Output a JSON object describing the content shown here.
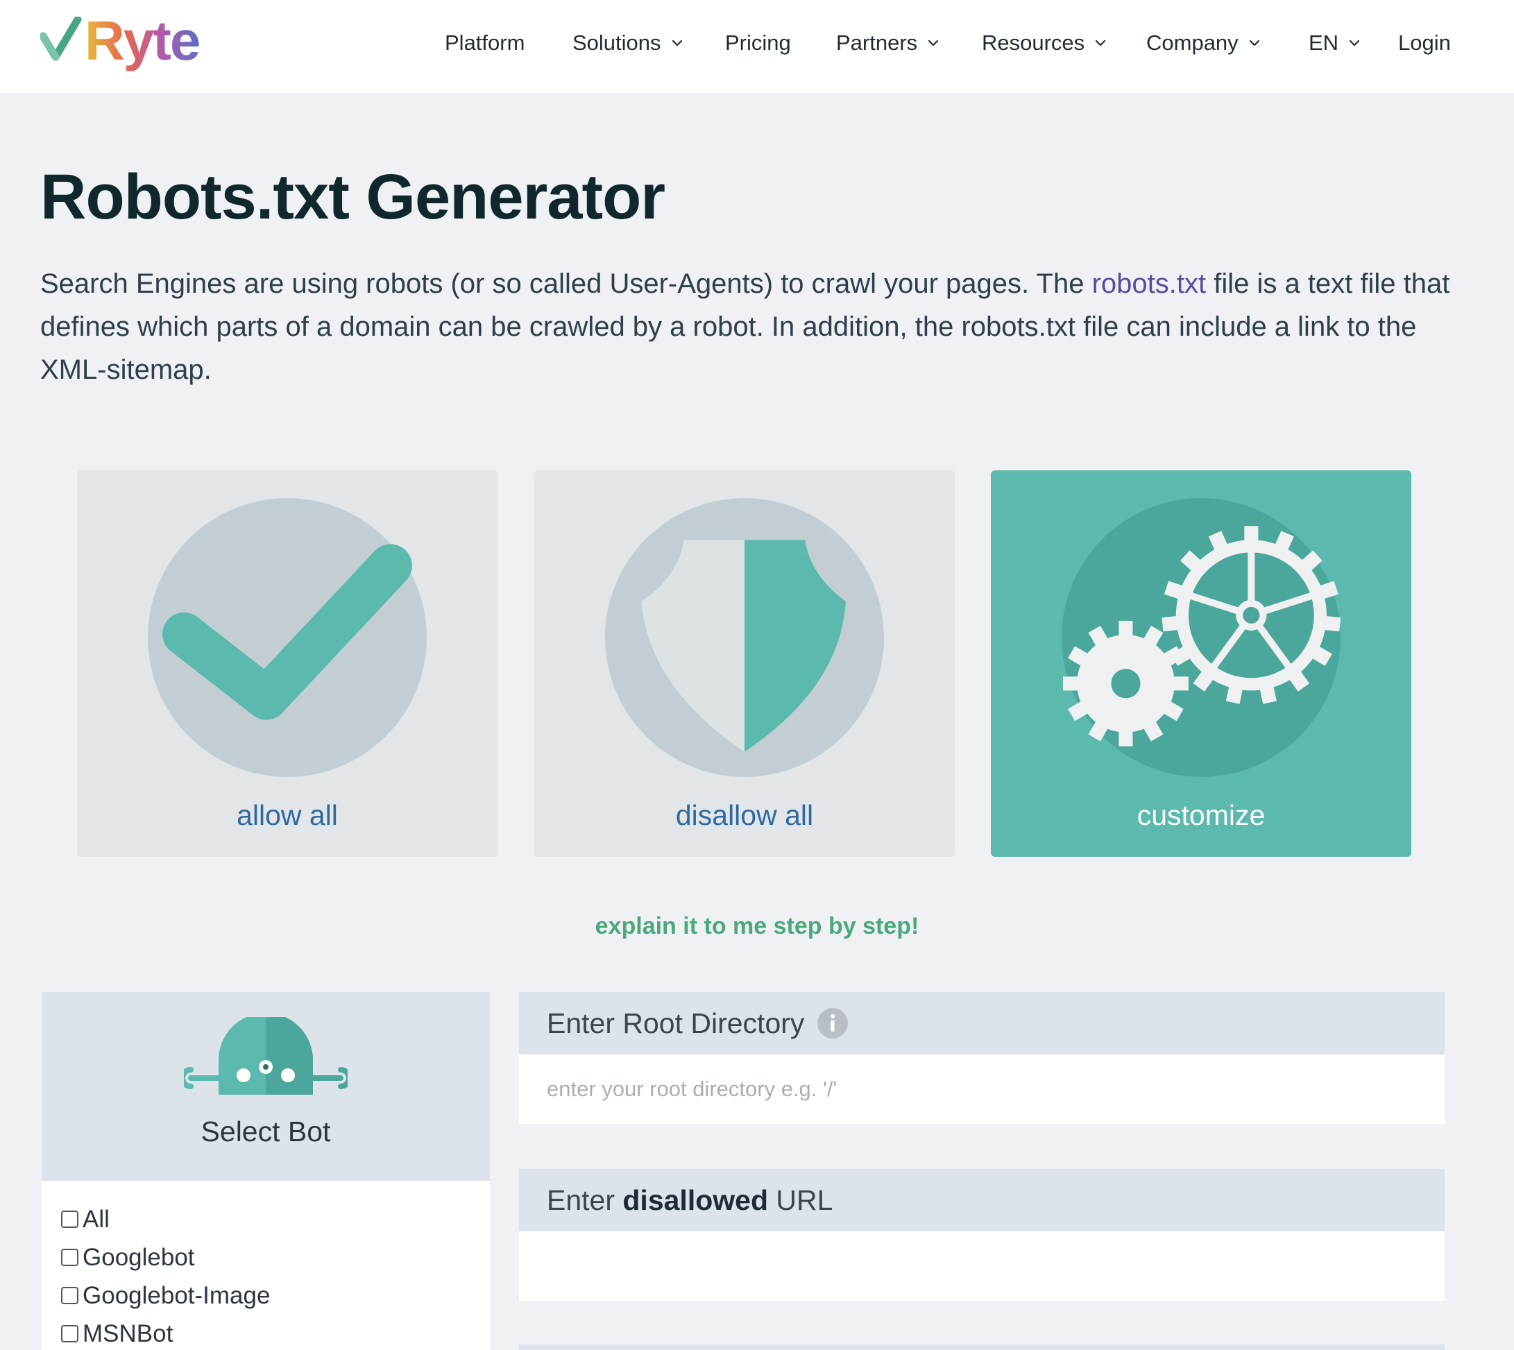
{
  "header": {
    "logo_text": "Ryte",
    "nav": [
      {
        "label": "Platform",
        "dropdown": false
      },
      {
        "label": "Solutions",
        "dropdown": true
      },
      {
        "label": "Pricing",
        "dropdown": false
      },
      {
        "label": "Partners",
        "dropdown": true
      },
      {
        "label": "Resources",
        "dropdown": true
      },
      {
        "label": "Company",
        "dropdown": true
      },
      {
        "label": "EN",
        "dropdown": true
      },
      {
        "label": "Login",
        "dropdown": false
      }
    ]
  },
  "main": {
    "title": "Robots.txt Generator",
    "intro_part1": "Search Engines are using robots (or so called User-Agents) to crawl your pages. The ",
    "intro_link": "robots.txt",
    "intro_part2": " file is a text file that defines which parts of a domain can be crawled by a robot. In addition, the robots.txt file can include a link to the XML-sitemap."
  },
  "options": {
    "allow_label": "allow all",
    "disallow_label": "disallow all",
    "customize_label": "customize",
    "selected": "customize"
  },
  "explain_link": "explain it to me step by step!",
  "bot_panel": {
    "title": "Select Bot",
    "bots": [
      "All",
      "Googlebot",
      "Googlebot-Image",
      "MSNBot"
    ]
  },
  "root_directory": {
    "label": "Enter Root Directory",
    "placeholder": "enter your root directory e.g. '/'",
    "value": ""
  },
  "disallowed_url": {
    "label_prefix": "Enter ",
    "label_bold": "disallowed",
    "label_suffix": " URL",
    "value": ""
  },
  "colors": {
    "teal": "#5bb9ad",
    "tile_gray": "#e2e6e9",
    "link_purple": "#574d9c",
    "explain_green": "#4ba87a",
    "tile_label_blue": "#2e6a9e"
  },
  "icons": [
    "checkmark-icon",
    "shield-icon",
    "gears-icon",
    "robot-icon",
    "info-icon",
    "chevron-down-icon"
  ]
}
